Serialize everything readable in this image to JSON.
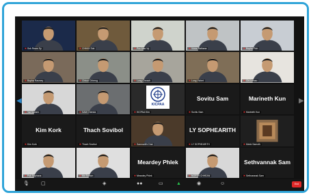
{
  "tiles": [
    {
      "label": "Sok Ream Sy",
      "kind": "video",
      "bg": "#1b2a4a"
    },
    {
      "label": "CHHAY Sok",
      "kind": "video",
      "bg": "#6f5a3c"
    },
    {
      "label": "Pov Mao Vy",
      "kind": "video",
      "bg": "#cfd3cc"
    },
    {
      "label": "Victor Rathana",
      "kind": "video",
      "bg": "#bfc3c5"
    },
    {
      "label": "Bopha Pich",
      "kind": "video",
      "bg": "#c8cdd3"
    },
    {
      "label": "Bopha Rasmey",
      "kind": "video",
      "bg": "#7a6a5a"
    },
    {
      "label": "Chhun Chheng",
      "kind": "video",
      "bg": "#8b8f88"
    },
    {
      "label": "Long Cheach",
      "kind": "video",
      "bg": "#a7a59c"
    },
    {
      "label": "Long Vichet",
      "kind": "video",
      "bg": "#7f6e57"
    },
    {
      "label": "Chi Lemao",
      "kind": "video",
      "bg": "#e7e4df"
    },
    {
      "label": "Yat Sovann",
      "kind": "video",
      "bg": "#d7d7d7"
    },
    {
      "label": "SAM Chenda",
      "kind": "video",
      "bg": "#6b6e70"
    },
    {
      "label": "KICPAA Kim",
      "kind": "logo",
      "bg": "#222222"
    },
    {
      "name": "Sovitu Sam",
      "label": "Sovitu Sam",
      "kind": "name"
    },
    {
      "name": "Marineth Kun",
      "label": "Marineth Kun",
      "kind": "name"
    },
    {
      "name": "Kim Kork",
      "label": "Kim Kork",
      "kind": "name"
    },
    {
      "name": "Thach Sovibol",
      "label": "Thach Sovibol",
      "kind": "name"
    },
    {
      "label": "Samnarith Chai",
      "kind": "video",
      "bg": "#4b3a2a"
    },
    {
      "name": "LY SOPHEARITH",
      "label": "LY SOPHEARITH",
      "kind": "name"
    },
    {
      "label": "Meek Samoth",
      "kind": "photo",
      "bg": "#1f1f1f"
    },
    {
      "label": "Pok Suphana",
      "kind": "video",
      "bg": "#dcdcdc"
    },
    {
      "label": "Mo Sothon",
      "kind": "video",
      "bg": "#dfdfdf"
    },
    {
      "name": "Meardey Phlek",
      "label": "Meardey Phlek",
      "kind": "name"
    },
    {
      "label": "NORTH CHHEAN",
      "kind": "video",
      "bg": "#d8d8d8"
    },
    {
      "name": "Sethvannak Sam",
      "label": "Sethvannak Sam",
      "kind": "name"
    }
  ],
  "logo_text": "KICPAA",
  "toolbar": {
    "end_label": "End"
  }
}
